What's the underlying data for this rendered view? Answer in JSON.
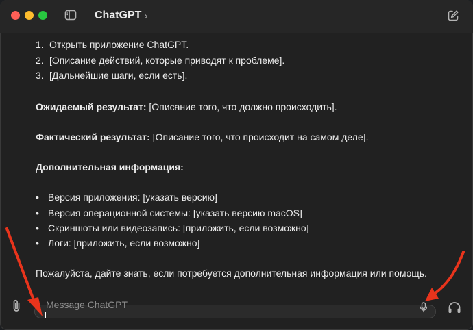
{
  "window": {
    "title": "ChatGPT",
    "title_chevron": "›",
    "colors": {
      "close": "#ff5f57",
      "minimize": "#febc2e",
      "maximize": "#28c840",
      "annotation": "#e8341c"
    }
  },
  "message": {
    "steps": [
      {
        "num": "1.",
        "text": "Открыть приложение ChatGPT."
      },
      {
        "num": "2.",
        "text": "[Описание действий, которые приводят к проблеме]."
      },
      {
        "num": "3.",
        "text": "[Дальнейшие шаги, если есть]."
      }
    ],
    "expected": {
      "label": "Ожидаемый результат:",
      "text": " [Описание того, что должно происходить]."
    },
    "actual": {
      "label": "Фактический результат:",
      "text": " [Описание того, что происходит на самом деле]."
    },
    "additional_heading": "Дополнительная информация:",
    "bullets": [
      "Версия приложения: [указать версию]",
      "Версия операционной системы: [указать версию macOS]",
      "Скриншоты или видеозапись: [приложить, если возможно]",
      "Логи: [приложить, если возможно]"
    ],
    "bullet_char": "•",
    "closing": "Пожалуйста, дайте знать, если потребуется дополнительная информация или помощь."
  },
  "composer": {
    "placeholder": "Message ChatGPT",
    "value": ""
  },
  "icons": {
    "sidebar_toggle": "sidebar-toggle-icon",
    "new_chat": "compose-icon",
    "attach": "paperclip-icon",
    "mic": "microphone-icon",
    "voice": "headphones-icon"
  }
}
